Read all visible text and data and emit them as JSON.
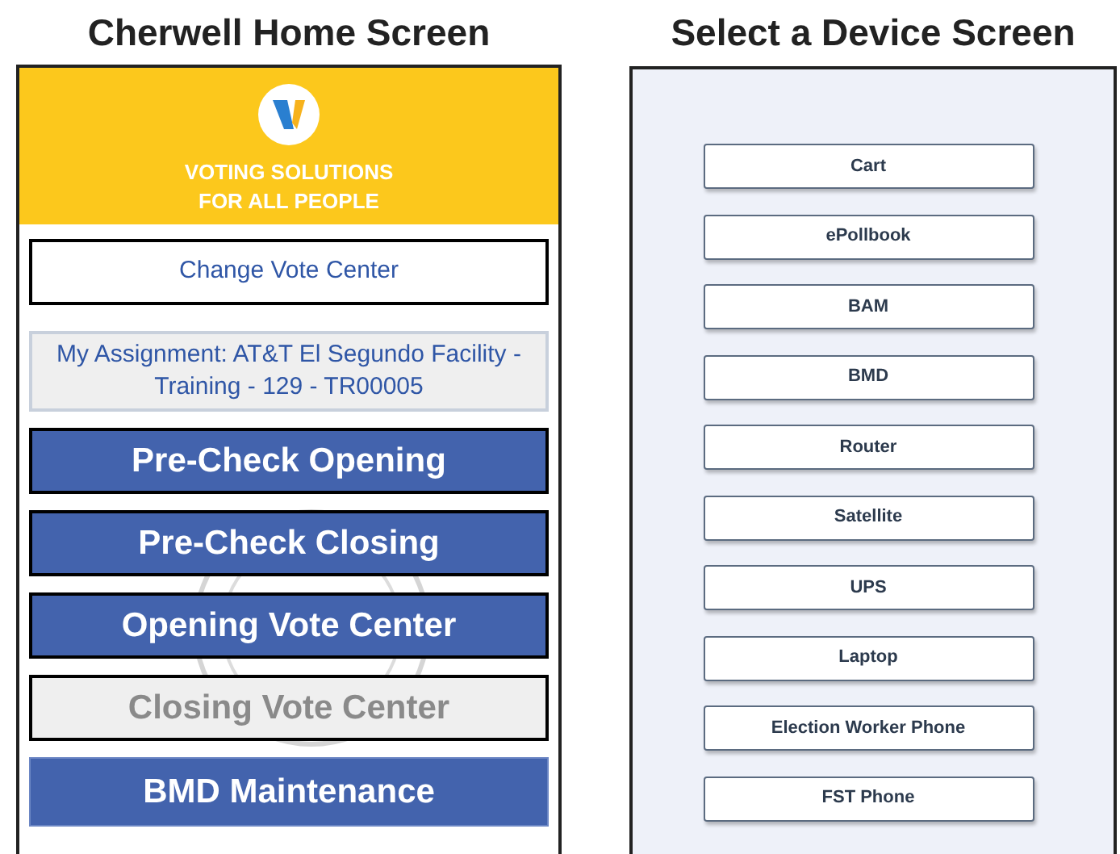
{
  "panels": [
    {
      "title": "Cherwell Home Screen"
    },
    {
      "title": "Select a Device Screen"
    }
  ],
  "home": {
    "tagline": [
      "VOTING SOLUTIONS",
      "FOR ALL PEOPLE"
    ],
    "items": [
      {
        "kind": "outline",
        "label": "Change Vote Center",
        "disabled": false
      },
      {
        "kind": "info",
        "label": "My Assignment: AT&T El Segundo Facility - Training - 129 - TR00005",
        "disabled": false
      },
      {
        "kind": "primary",
        "label": "Pre-Check Opening",
        "disabled": false
      },
      {
        "kind": "primary",
        "label": "Pre-Check Closing",
        "disabled": false
      },
      {
        "kind": "primary",
        "label": "Opening Vote Center",
        "disabled": false
      },
      {
        "kind": "primary",
        "label": "Closing Vote Center",
        "disabled": true
      },
      {
        "kind": "flat",
        "label": "BMD Maintenance",
        "disabled": false
      }
    ]
  },
  "devices": [
    "Cart",
    "ePollbook",
    "BAM",
    "BMD",
    "Router",
    "Satellite",
    "UPS",
    "Laptop",
    "Election Worker Phone",
    "FST Phone"
  ]
}
